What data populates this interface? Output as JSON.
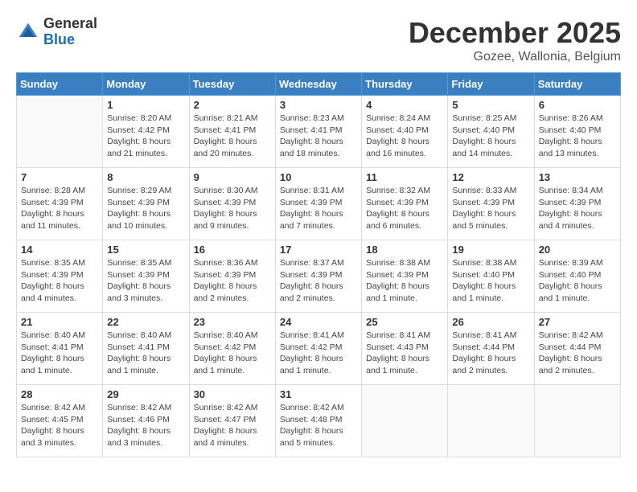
{
  "header": {
    "logo_general": "General",
    "logo_blue": "Blue",
    "month_title": "December 2025",
    "location": "Gozee, Wallonia, Belgium"
  },
  "weekdays": [
    "Sunday",
    "Monday",
    "Tuesday",
    "Wednesday",
    "Thursday",
    "Friday",
    "Saturday"
  ],
  "weeks": [
    [
      {
        "day": "",
        "sunrise": "",
        "sunset": "",
        "daylight": ""
      },
      {
        "day": "1",
        "sunrise": "Sunrise: 8:20 AM",
        "sunset": "Sunset: 4:42 PM",
        "daylight": "Daylight: 8 hours and 21 minutes."
      },
      {
        "day": "2",
        "sunrise": "Sunrise: 8:21 AM",
        "sunset": "Sunset: 4:41 PM",
        "daylight": "Daylight: 8 hours and 20 minutes."
      },
      {
        "day": "3",
        "sunrise": "Sunrise: 8:23 AM",
        "sunset": "Sunset: 4:41 PM",
        "daylight": "Daylight: 8 hours and 18 minutes."
      },
      {
        "day": "4",
        "sunrise": "Sunrise: 8:24 AM",
        "sunset": "Sunset: 4:40 PM",
        "daylight": "Daylight: 8 hours and 16 minutes."
      },
      {
        "day": "5",
        "sunrise": "Sunrise: 8:25 AM",
        "sunset": "Sunset: 4:40 PM",
        "daylight": "Daylight: 8 hours and 14 minutes."
      },
      {
        "day": "6",
        "sunrise": "Sunrise: 8:26 AM",
        "sunset": "Sunset: 4:40 PM",
        "daylight": "Daylight: 8 hours and 13 minutes."
      }
    ],
    [
      {
        "day": "7",
        "sunrise": "Sunrise: 8:28 AM",
        "sunset": "Sunset: 4:39 PM",
        "daylight": "Daylight: 8 hours and 11 minutes."
      },
      {
        "day": "8",
        "sunrise": "Sunrise: 8:29 AM",
        "sunset": "Sunset: 4:39 PM",
        "daylight": "Daylight: 8 hours and 10 minutes."
      },
      {
        "day": "9",
        "sunrise": "Sunrise: 8:30 AM",
        "sunset": "Sunset: 4:39 PM",
        "daylight": "Daylight: 8 hours and 9 minutes."
      },
      {
        "day": "10",
        "sunrise": "Sunrise: 8:31 AM",
        "sunset": "Sunset: 4:39 PM",
        "daylight": "Daylight: 8 hours and 7 minutes."
      },
      {
        "day": "11",
        "sunrise": "Sunrise: 8:32 AM",
        "sunset": "Sunset: 4:39 PM",
        "daylight": "Daylight: 8 hours and 6 minutes."
      },
      {
        "day": "12",
        "sunrise": "Sunrise: 8:33 AM",
        "sunset": "Sunset: 4:39 PM",
        "daylight": "Daylight: 8 hours and 5 minutes."
      },
      {
        "day": "13",
        "sunrise": "Sunrise: 8:34 AM",
        "sunset": "Sunset: 4:39 PM",
        "daylight": "Daylight: 8 hours and 4 minutes."
      }
    ],
    [
      {
        "day": "14",
        "sunrise": "Sunrise: 8:35 AM",
        "sunset": "Sunset: 4:39 PM",
        "daylight": "Daylight: 8 hours and 4 minutes."
      },
      {
        "day": "15",
        "sunrise": "Sunrise: 8:35 AM",
        "sunset": "Sunset: 4:39 PM",
        "daylight": "Daylight: 8 hours and 3 minutes."
      },
      {
        "day": "16",
        "sunrise": "Sunrise: 8:36 AM",
        "sunset": "Sunset: 4:39 PM",
        "daylight": "Daylight: 8 hours and 2 minutes."
      },
      {
        "day": "17",
        "sunrise": "Sunrise: 8:37 AM",
        "sunset": "Sunset: 4:39 PM",
        "daylight": "Daylight: 8 hours and 2 minutes."
      },
      {
        "day": "18",
        "sunrise": "Sunrise: 8:38 AM",
        "sunset": "Sunset: 4:39 PM",
        "daylight": "Daylight: 8 hours and 1 minute."
      },
      {
        "day": "19",
        "sunrise": "Sunrise: 8:38 AM",
        "sunset": "Sunset: 4:40 PM",
        "daylight": "Daylight: 8 hours and 1 minute."
      },
      {
        "day": "20",
        "sunrise": "Sunrise: 8:39 AM",
        "sunset": "Sunset: 4:40 PM",
        "daylight": "Daylight: 8 hours and 1 minute."
      }
    ],
    [
      {
        "day": "21",
        "sunrise": "Sunrise: 8:40 AM",
        "sunset": "Sunset: 4:41 PM",
        "daylight": "Daylight: 8 hours and 1 minute."
      },
      {
        "day": "22",
        "sunrise": "Sunrise: 8:40 AM",
        "sunset": "Sunset: 4:41 PM",
        "daylight": "Daylight: 8 hours and 1 minute."
      },
      {
        "day": "23",
        "sunrise": "Sunrise: 8:40 AM",
        "sunset": "Sunset: 4:42 PM",
        "daylight": "Daylight: 8 hours and 1 minute."
      },
      {
        "day": "24",
        "sunrise": "Sunrise: 8:41 AM",
        "sunset": "Sunset: 4:42 PM",
        "daylight": "Daylight: 8 hours and 1 minute."
      },
      {
        "day": "25",
        "sunrise": "Sunrise: 8:41 AM",
        "sunset": "Sunset: 4:43 PM",
        "daylight": "Daylight: 8 hours and 1 minute."
      },
      {
        "day": "26",
        "sunrise": "Sunrise: 8:41 AM",
        "sunset": "Sunset: 4:44 PM",
        "daylight": "Daylight: 8 hours and 2 minutes."
      },
      {
        "day": "27",
        "sunrise": "Sunrise: 8:42 AM",
        "sunset": "Sunset: 4:44 PM",
        "daylight": "Daylight: 8 hours and 2 minutes."
      }
    ],
    [
      {
        "day": "28",
        "sunrise": "Sunrise: 8:42 AM",
        "sunset": "Sunset: 4:45 PM",
        "daylight": "Daylight: 8 hours and 3 minutes."
      },
      {
        "day": "29",
        "sunrise": "Sunrise: 8:42 AM",
        "sunset": "Sunset: 4:46 PM",
        "daylight": "Daylight: 8 hours and 3 minutes."
      },
      {
        "day": "30",
        "sunrise": "Sunrise: 8:42 AM",
        "sunset": "Sunset: 4:47 PM",
        "daylight": "Daylight: 8 hours and 4 minutes."
      },
      {
        "day": "31",
        "sunrise": "Sunrise: 8:42 AM",
        "sunset": "Sunset: 4:48 PM",
        "daylight": "Daylight: 8 hours and 5 minutes."
      },
      {
        "day": "",
        "sunrise": "",
        "sunset": "",
        "daylight": ""
      },
      {
        "day": "",
        "sunrise": "",
        "sunset": "",
        "daylight": ""
      },
      {
        "day": "",
        "sunrise": "",
        "sunset": "",
        "daylight": ""
      }
    ]
  ]
}
